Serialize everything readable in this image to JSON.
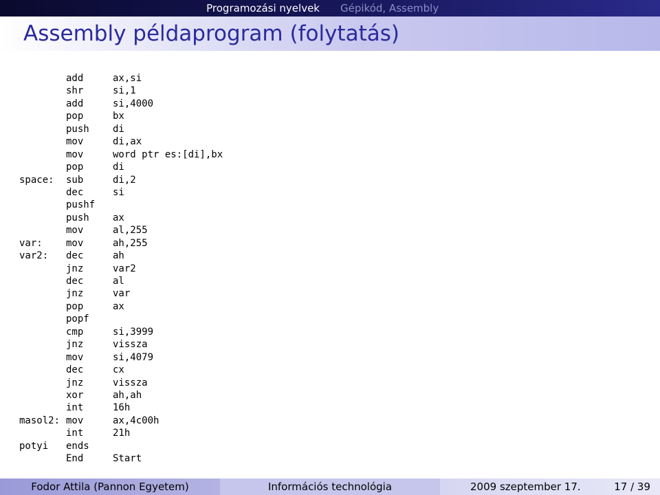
{
  "header": {
    "section_left": "Programozási nyelvek",
    "section_right": "Gépikód, Assembly"
  },
  "title": "Assembly példaprogram (folytatás)",
  "code_lines": [
    {
      "label": "",
      "instr": "add",
      "operands": "ax,si"
    },
    {
      "label": "",
      "instr": "shr",
      "operands": "si,1"
    },
    {
      "label": "",
      "instr": "add",
      "operands": "si,4000"
    },
    {
      "label": "",
      "instr": "pop",
      "operands": "bx"
    },
    {
      "label": "",
      "instr": "push",
      "operands": "di"
    },
    {
      "label": "",
      "instr": "mov",
      "operands": "di,ax"
    },
    {
      "label": "",
      "instr": "mov",
      "operands": "word ptr es:[di],bx"
    },
    {
      "label": "",
      "instr": "pop",
      "operands": "di"
    },
    {
      "label": "space:",
      "instr": "sub",
      "operands": "di,2"
    },
    {
      "label": "",
      "instr": "dec",
      "operands": "si"
    },
    {
      "label": "",
      "instr": "pushf",
      "operands": ""
    },
    {
      "label": "",
      "instr": "push",
      "operands": "ax"
    },
    {
      "label": "",
      "instr": "mov",
      "operands": "al,255"
    },
    {
      "label": "var:",
      "instr": "mov",
      "operands": "ah,255"
    },
    {
      "label": "var2:",
      "instr": "dec",
      "operands": "ah"
    },
    {
      "label": "",
      "instr": "jnz",
      "operands": "var2"
    },
    {
      "label": "",
      "instr": "dec",
      "operands": "al"
    },
    {
      "label": "",
      "instr": "jnz",
      "operands": "var"
    },
    {
      "label": "",
      "instr": "pop",
      "operands": "ax"
    },
    {
      "label": "",
      "instr": "popf",
      "operands": ""
    },
    {
      "label": "",
      "instr": "cmp",
      "operands": "si,3999"
    },
    {
      "label": "",
      "instr": "jnz",
      "operands": "vissza"
    },
    {
      "label": "",
      "instr": "mov",
      "operands": "si,4079"
    },
    {
      "label": "",
      "instr": "dec",
      "operands": "cx"
    },
    {
      "label": "",
      "instr": "jnz",
      "operands": "vissza"
    },
    {
      "label": "",
      "instr": "xor",
      "operands": "ah,ah"
    },
    {
      "label": "",
      "instr": "int",
      "operands": "16h"
    },
    {
      "label": "masol2:",
      "instr": "mov",
      "operands": "ax,4c00h"
    },
    {
      "label": "",
      "instr": "int",
      "operands": "21h"
    },
    {
      "label": "potyi",
      "instr": "ends",
      "operands": ""
    },
    {
      "label": "",
      "instr": "End",
      "operands": "Start"
    }
  ],
  "footer": {
    "author": "Fodor Attila (Pannon Egyetem)",
    "course": "Információs technológia",
    "date": "2009 szeptember 17.",
    "page": "17 / 39"
  }
}
